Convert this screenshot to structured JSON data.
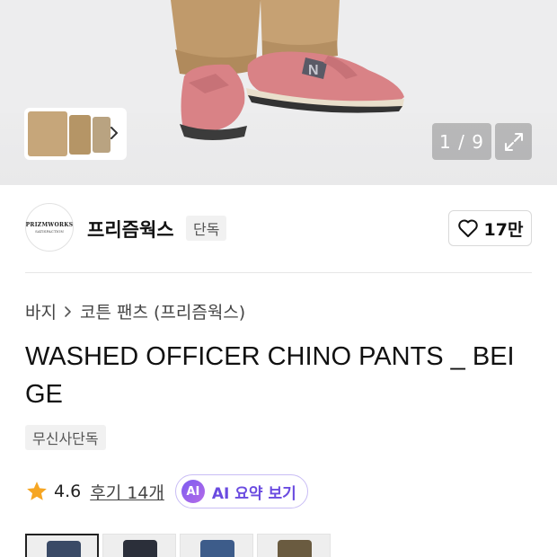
{
  "gallery": {
    "counter_text": "1 / 9",
    "current": 1,
    "total": 9,
    "colors": {
      "pants": "#c09a6b",
      "shoe": "#d98286",
      "shoe_dark": "#3b3b3b",
      "background": "#ededee"
    }
  },
  "brand": {
    "logo_text_top": "PRIZMWORKS",
    "logo_text_bottom": "SATISFACTION",
    "name": "프리즘웍스",
    "exclusive_tag": "단독"
  },
  "likes": {
    "count": "17만",
    "icon": "heart-outline-icon"
  },
  "breadcrumb": [
    {
      "label": "바지"
    },
    {
      "label": "코튼 팬츠 (프리즘웍스)"
    }
  ],
  "product": {
    "title": "WASHED OFFICER CHINO PANTS _ BEIGE",
    "tag": "무신사단독"
  },
  "rating": {
    "value": "4.6",
    "review_link": "후기 14개",
    "star_color": "#f6a623"
  },
  "ai_summary": {
    "badge": "AI",
    "label": "AI 요약 보기"
  },
  "swatches": [
    {
      "color": "#3a4a66",
      "active": true
    },
    {
      "color": "#2b2f3a",
      "active": false
    },
    {
      "color": "#3d5c8a",
      "active": false
    },
    {
      "color": "#6a5b40",
      "active": false
    }
  ]
}
